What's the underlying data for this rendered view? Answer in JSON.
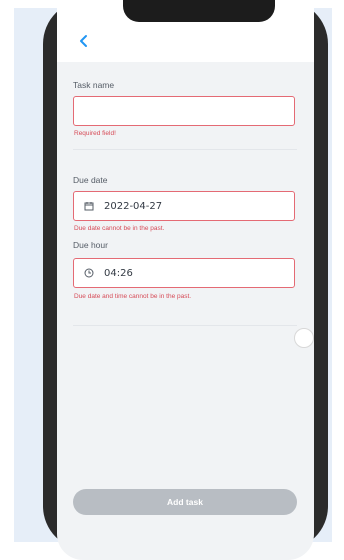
{
  "header": {
    "back_icon": "chevron-left-icon"
  },
  "form": {
    "task_name": {
      "label": "Task name",
      "value": "",
      "error": "Required field!"
    },
    "due_date": {
      "label": "Due date",
      "value": "2022-04-27",
      "icon": "calendar-icon",
      "error": "Due date cannot be in the past."
    },
    "due_hour": {
      "label": "Due hour",
      "value": "04:26",
      "icon": "clock-icon",
      "error": "Due date and time cannot be in the past."
    }
  },
  "actions": {
    "add_label": "Add task"
  },
  "colors": {
    "accent": "#2196f3",
    "error": "#d64b57",
    "field_border": "#e46a74",
    "button_disabled": "#b8bdc3"
  }
}
